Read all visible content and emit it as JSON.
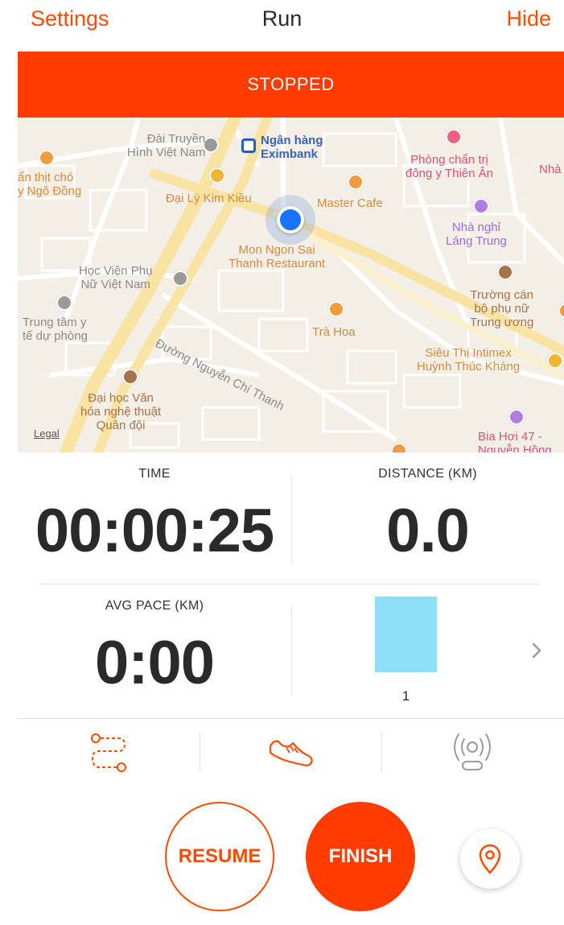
{
  "nav": {
    "left": "Settings",
    "title": "Run",
    "right": "Hide"
  },
  "status_banner": "STOPPED",
  "map": {
    "labels": [
      {
        "text": "Đài Truyền\nHình Việt Nam",
        "style": "gray"
      },
      {
        "text": "Ngân hàng\nEximbank",
        "style": "blue"
      },
      {
        "text": "Phòng chẩn trị\nđông y Thiên Ân",
        "style": "pink"
      },
      {
        "text": "Nhà",
        "style": "pink"
      },
      {
        "text": "ẩn thịt chó\ny Ngô Đồng",
        "style": "orange"
      },
      {
        "text": "Đại Lý Kim Kiều",
        "style": "orange"
      },
      {
        "text": "Master Cafe",
        "style": "orange"
      },
      {
        "text": "Nhà nghỉ\nLáng Trung",
        "style": "purple"
      },
      {
        "text": "Mon Ngon Sai\nThanh Restaurant",
        "style": "orange"
      },
      {
        "text": "Học Viện Phụ\nNữ Việt Nam",
        "style": "gray"
      },
      {
        "text": "Trường cán\nbộ phụ nữ\nTrung ương",
        "style": "brown"
      },
      {
        "text": "Trung tâm y\ntế dự phòng",
        "style": "gray"
      },
      {
        "text": "Đường Nguyễn Chí Thanh",
        "style": "gray"
      },
      {
        "text": "Trà Hoa",
        "style": "orange"
      },
      {
        "text": "Siêu Thị Intimex\nHuỳnh Thúc Kháng",
        "style": "orange"
      },
      {
        "text": "Đại học Văn\nhóa nghệ thuật\nQuân đội",
        "style": "brown"
      },
      {
        "text": "Bia Hơi 47 -\nNguyễn Hồng",
        "style": "pink"
      }
    ],
    "legal": "Legal"
  },
  "stats": {
    "time_label": "TIME",
    "time_value": "00:00:25",
    "distance_label": "DISTANCE (KM)",
    "distance_value": "0.0",
    "pace_label": "AVG PACE (KM)",
    "pace_value": "0:00",
    "split_bar_label": "1"
  },
  "buttons": {
    "resume": "RESUME",
    "finish": "FINISH"
  },
  "colors": {
    "accent": "#fc4c02",
    "banner": "#ff3c00",
    "split_bar": "#8ddff7",
    "location": "#1a73ff"
  },
  "icons": {
    "route": "route-icon",
    "shoe": "shoe-icon",
    "beacon": "beacon-icon",
    "pin": "location-pin-icon",
    "chevron": "chevron-right-icon"
  }
}
